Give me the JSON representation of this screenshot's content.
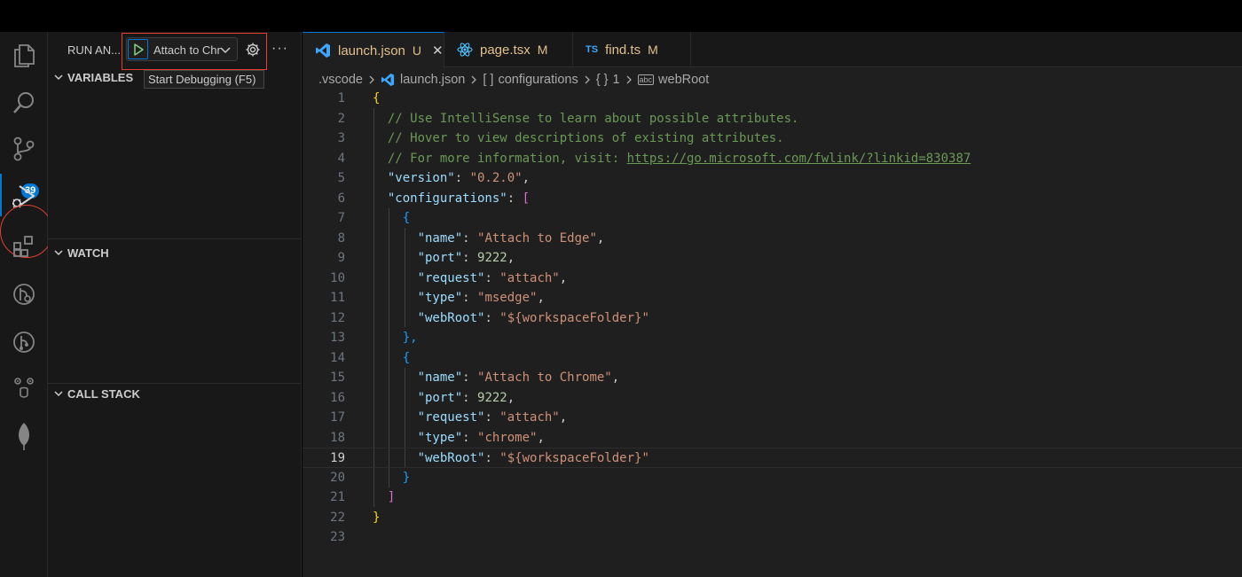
{
  "sidebar": {
    "title": "RUN AN...",
    "run_config": "Attach to Chrome",
    "tooltip": "Start Debugging (F5)",
    "sections": {
      "variables": "VARIABLES",
      "watch": "WATCH",
      "call_stack": "CALL STACK"
    }
  },
  "activity_bar": {
    "items": [
      "files-icon",
      "search-icon",
      "source-control-icon",
      "run-debug-icon",
      "extensions-icon",
      "remote-explorer-icon",
      "git-graph-icon",
      "copilot-icon",
      "mongodb-icon"
    ],
    "source_control_badge": "39"
  },
  "tabs": [
    {
      "name": "launch.json",
      "status": "U",
      "active": true,
      "icon": "vscode-icon"
    },
    {
      "name": "page.tsx",
      "status": "M",
      "active": false,
      "icon": "react-icon"
    },
    {
      "name": "find.ts",
      "status": "M",
      "active": false,
      "icon": "ts-icon",
      "icon_text": "TS"
    }
  ],
  "breadcrumb": {
    "folder": ".vscode",
    "file": "launch.json",
    "configs": "configurations",
    "index": "1",
    "prop": "webRoot",
    "array_glyph": "[ ]",
    "object_glyph": "{ }",
    "string_glyph": "abc"
  },
  "code": {
    "current_line": 19,
    "line_numbers": [
      "1",
      "2",
      "3",
      "4",
      "5",
      "6",
      "7",
      "8",
      "9",
      "10",
      "11",
      "12",
      "13",
      "14",
      "15",
      "16",
      "17",
      "18",
      "19",
      "20",
      "21",
      "22",
      "23"
    ],
    "l1": "{",
    "l2": "// Use IntelliSense to learn about possible attributes.",
    "l3": "// Hover to view descriptions of existing attributes.",
    "l4_comment": "// For more information, visit: ",
    "l4_url": "https://go.microsoft.com/fwlink/?linkid=830387",
    "k_version": "\"version\"",
    "v_version": "\"0.2.0\"",
    "k_configurations": "\"configurations\"",
    "open_arr": "[",
    "close_arr": "]",
    "open_obj": "{",
    "close_obj": "}",
    "close_obj_comma": "},",
    "k_name": "\"name\"",
    "k_port": "\"port\"",
    "k_request": "\"request\"",
    "k_type": "\"type\"",
    "k_webroot": "\"webRoot\"",
    "colon": ": ",
    "comma": ",",
    "configs": [
      {
        "name": "\"Attach to Edge\"",
        "port": "9222",
        "request": "\"attach\"",
        "type": "\"msedge\"",
        "webRoot": "\"${workspaceFolder}\""
      },
      {
        "name": "\"Attach to Chrome\"",
        "port": "9222",
        "request": "\"attach\"",
        "type": "\"chrome\"",
        "webRoot": "\"${workspaceFolder}\""
      }
    ]
  },
  "colors": {
    "accent": "#0078d4",
    "highlight": "#e0402d",
    "modified": "#e2c08d"
  }
}
